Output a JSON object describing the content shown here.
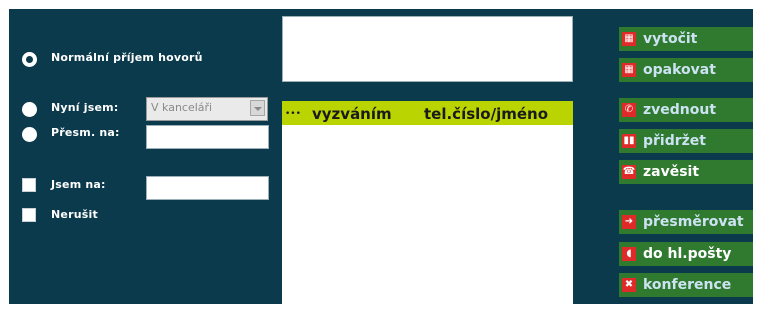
{
  "options": {
    "normal": {
      "label": "Normální příjem hovorů"
    },
    "now": {
      "label": "Nyní jsem:",
      "select_value": "V kanceláři"
    },
    "forward": {
      "label": "Přesm. na:",
      "input_value": ""
    },
    "at": {
      "label": "Jsem na:",
      "input_value": ""
    },
    "dnd": {
      "label": "Nerušit"
    }
  },
  "display": {
    "value": ""
  },
  "calls": {
    "columns": [
      "vyzváním",
      "tel.číslo/jméno"
    ],
    "rows": []
  },
  "actions": [
    {
      "label": "vytočit",
      "icon": "grid-icon",
      "glyph": "▦",
      "label_color": "#cde3f3"
    },
    {
      "label": "opakovat",
      "icon": "grid-icon",
      "glyph": "▦",
      "label_color": "#cde3f3"
    },
    {
      "label": "zvednout",
      "icon": "phone-icon",
      "glyph": "✆",
      "label_color": "#cde3f3"
    },
    {
      "label": "přidržet",
      "icon": "pause-icon",
      "glyph": "▮▮",
      "label_color": "#cde3f3"
    },
    {
      "label": "zavěsit",
      "icon": "hangup-icon",
      "glyph": "☎",
      "label_color": "#ffffff"
    },
    {
      "label": "přesměrovat",
      "icon": "arrow-right-icon",
      "glyph": "➜",
      "label_color": "#cde3f3"
    },
    {
      "label": "do hl.pošty",
      "icon": "voicemail-icon",
      "glyph": "◖",
      "label_color": "#ffffff"
    },
    {
      "label": "konference",
      "icon": "conference-icon",
      "glyph": "✖",
      "label_color": "#cde3f3"
    }
  ],
  "colors": {
    "panel_bg": "#0b3a4c",
    "header_bg": "#b9d400",
    "button_bg": "#2f7a2f",
    "icon_bg": "#e02a2a"
  }
}
